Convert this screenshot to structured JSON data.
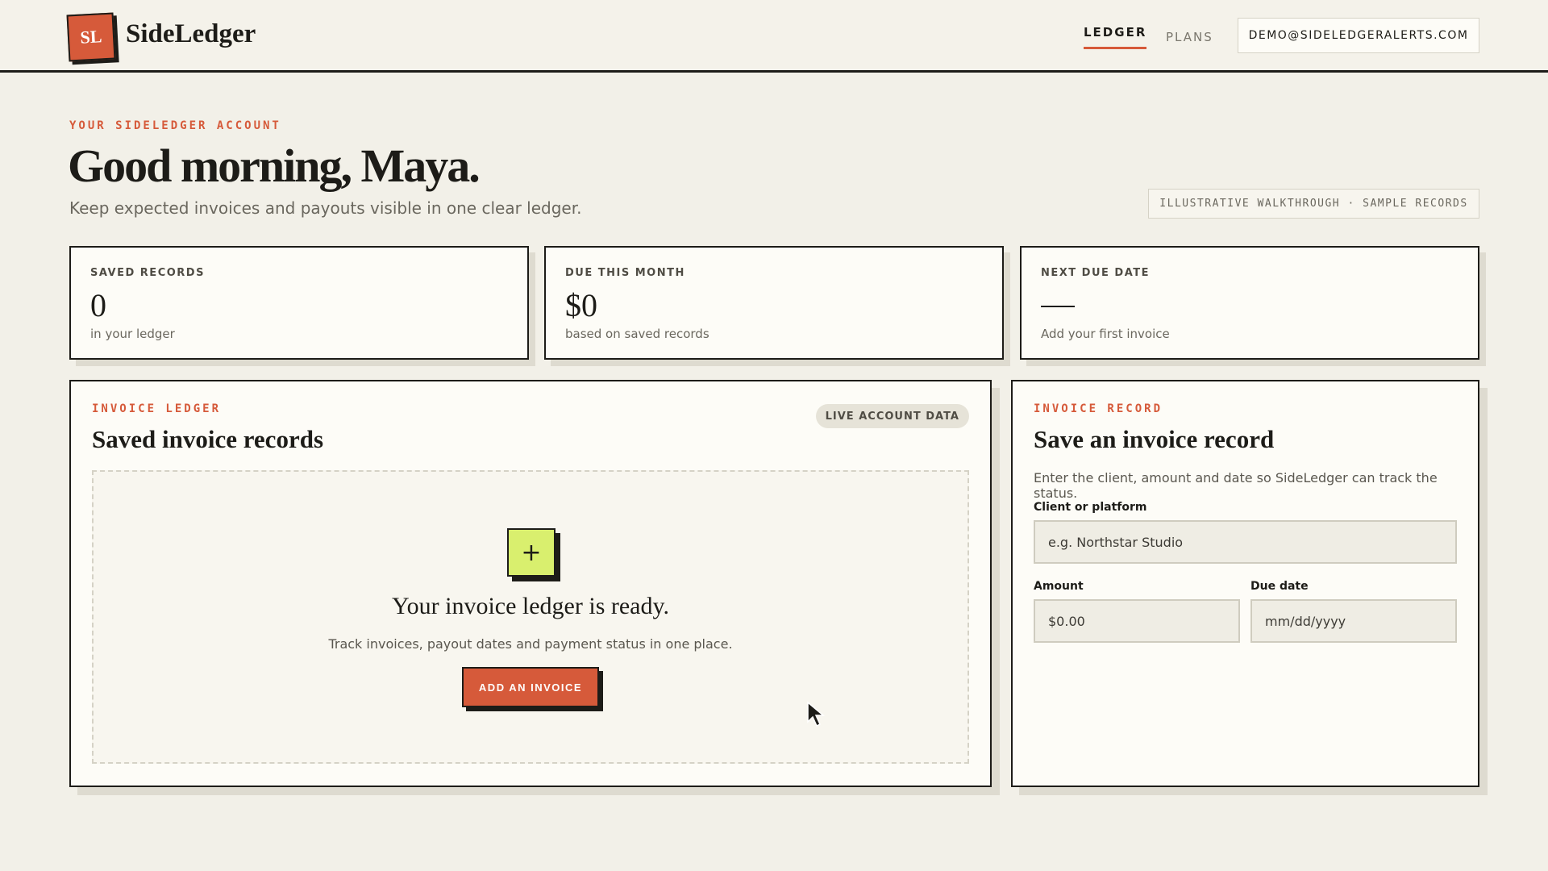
{
  "header": {
    "logo_text": "SL",
    "brand": "SideLedger",
    "nav": [
      {
        "label": "LEDGER",
        "active": true
      },
      {
        "label": "PLANS",
        "active": false
      }
    ],
    "account_email": "DEMO@SIDELEDGERALERTS.COM"
  },
  "hero": {
    "eyebrow": "YOUR SIDELEDGER ACCOUNT",
    "greeting": "Good morning, Maya.",
    "subtitle": "Keep expected invoices and payouts visible in one clear ledger.",
    "walkthrough_chip": "ILLUSTRATIVE WALKTHROUGH · SAMPLE RECORDS"
  },
  "stats": [
    {
      "label": "SAVED RECORDS",
      "value": "0",
      "note": "in your ledger"
    },
    {
      "label": "DUE THIS MONTH",
      "value": "$0",
      "note": "based on saved records"
    },
    {
      "label": "NEXT DUE DATE",
      "value": "",
      "note": "Add your first invoice"
    }
  ],
  "ledger_panel": {
    "eyebrow": "INVOICE LEDGER",
    "title": "Saved invoice records",
    "chip": "LIVE ACCOUNT DATA",
    "empty": {
      "icon": "+",
      "title": "Your invoice ledger is ready.",
      "subtitle": "Track invoices, payout dates and payment status in one place.",
      "button": "ADD AN INVOICE"
    }
  },
  "record_panel": {
    "eyebrow": "INVOICE RECORD",
    "title": "Save an invoice record",
    "description": "Enter the client, amount and date so SideLedger can track the status.",
    "client_label": "Client or platform",
    "client_placeholder": "e.g. Northstar Studio",
    "amount_label": "Amount",
    "amount_placeholder": "$0.00",
    "due_label": "Due date",
    "due_placeholder": "mm/dd/yyyy"
  },
  "colors": {
    "accent": "#d65a3a",
    "highlight": "#d9ef6e",
    "background": "#f2f0e8",
    "ink": "#1d1c18"
  },
  "icons": {
    "add": "plus-icon",
    "cursor": "mouse-cursor-icon"
  }
}
